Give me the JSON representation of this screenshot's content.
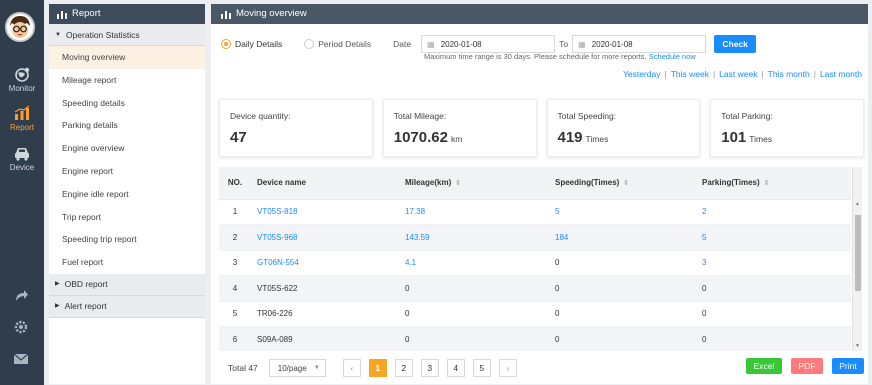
{
  "rail": {
    "items": [
      {
        "label": "Monitor",
        "icon": "globe-icon"
      },
      {
        "label": "Report",
        "icon": "chart-icon",
        "active": true
      },
      {
        "label": "Device",
        "icon": "car-icon"
      }
    ]
  },
  "menu": {
    "title": "Report",
    "group_open": "Operation Statistics",
    "items": [
      "Moving overview",
      "Mileage report",
      "Speeding details",
      "Parking details",
      "Engine overview",
      "Engine report",
      "Engine idle report",
      "Trip report",
      "Speeding trip report",
      "Fuel report"
    ],
    "group_obd": "OBD report",
    "group_alert": "Alert report"
  },
  "main": {
    "title": "Moving overview",
    "radio_daily": "Daily Details",
    "radio_period": "Period Details",
    "date_label": "Date",
    "to_label": "To",
    "date_from": "2020-01-08",
    "date_to": "2020-01-08",
    "check": "Check",
    "hint": "Maximum time range is 30 days. Please schedule for more reports.",
    "hint_link": "Schedule now",
    "quick": [
      "Yesterday",
      "This week",
      "Last week",
      "This month",
      "Last month"
    ]
  },
  "cards": [
    {
      "title": "Device quantity:",
      "value": "47",
      "unit": ""
    },
    {
      "title": "Total Mileage:",
      "value": "1070.62",
      "unit": "km"
    },
    {
      "title": "Total Speeding:",
      "value": "419",
      "unit": "Times"
    },
    {
      "title": "Total Parking:",
      "value": "101",
      "unit": "Times"
    }
  ],
  "table": {
    "headers": [
      "NO.",
      "Device name",
      "Mileage(km)",
      "Speeding(Times)",
      "Parking(Times)"
    ],
    "rows": [
      [
        "1",
        "VT05S-818",
        "17.38",
        "5",
        "2"
      ],
      [
        "2",
        "VT05S-968",
        "143.59",
        "184",
        "5"
      ],
      [
        "3",
        "GT06N-554",
        "4.1",
        "0",
        "3"
      ],
      [
        "4",
        "VT05S-622",
        "0",
        "0",
        "0"
      ],
      [
        "5",
        "TR06-226",
        "0",
        "0",
        "0"
      ],
      [
        "6",
        "S09A-089",
        "0",
        "0",
        "0"
      ]
    ]
  },
  "footer": {
    "total": "Total 47",
    "page_size": "10/page",
    "pages": [
      "1",
      "2",
      "3",
      "4",
      "5"
    ],
    "excel": "Excel",
    "pdf": "PDF",
    "print": "Print"
  },
  "colors": {
    "accent": "#f6a623",
    "link": "#1a8cff",
    "excel": "#37c737",
    "pdf": "#ff7b7b"
  }
}
